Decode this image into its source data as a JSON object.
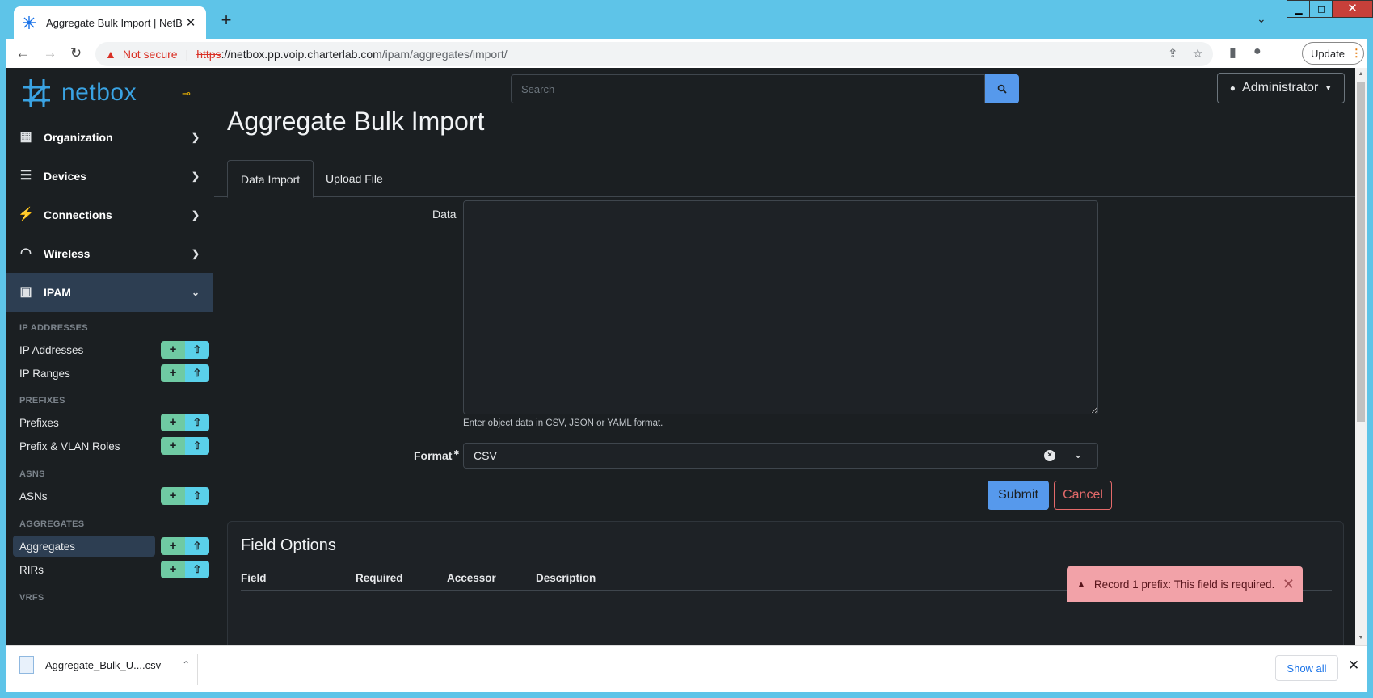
{
  "browser": {
    "tab_title": "Aggregate Bulk Import | NetBox",
    "new_tab": "+",
    "security_label": "Not secure",
    "url_scheme": "https",
    "url_host": "://netbox.pp.voip.charterlab.com",
    "url_path": "/ipam/aggregates/import/",
    "update_label": "Update",
    "update_dots": "⋮"
  },
  "app": {
    "logo_text": "netbox",
    "search_placeholder": "Search",
    "user_label": "Administrator"
  },
  "sidebar": {
    "menus": [
      {
        "label": "Organization",
        "icon": "building-icon"
      },
      {
        "label": "Devices",
        "icon": "server-icon"
      },
      {
        "label": "Connections",
        "icon": "plug-icon"
      },
      {
        "label": "Wireless",
        "icon": "wifi-icon"
      },
      {
        "label": "IPAM",
        "icon": "ipam-icon"
      }
    ],
    "sections": [
      {
        "heading": "IP ADDRESSES",
        "items": [
          "IP Addresses",
          "IP Ranges"
        ]
      },
      {
        "heading": "PREFIXES",
        "items": [
          "Prefixes",
          "Prefix & VLAN Roles"
        ]
      },
      {
        "heading": "ASNS",
        "items": [
          "ASNs"
        ]
      },
      {
        "heading": "AGGREGATES",
        "items": [
          "Aggregates",
          "RIRs"
        ]
      }
    ],
    "partial_section": "VRFS",
    "selected_item": "Aggregates"
  },
  "main": {
    "title": "Aggregate Bulk Import",
    "tabs": [
      "Data Import",
      "Upload File"
    ],
    "data_label": "Data",
    "data_help": "Enter object data in CSV, JSON or YAML format.",
    "format_label": "Format",
    "format_value": "CSV",
    "submit_label": "Submit",
    "cancel_label": "Cancel"
  },
  "field_options": {
    "title": "Field Options",
    "columns": [
      "Field",
      "Required",
      "Accessor",
      "Description"
    ]
  },
  "toast": {
    "message": "Record 1 prefix: This field is required."
  },
  "downloads": {
    "filename": "Aggregate_Bulk_U....csv",
    "show_all": "Show all"
  },
  "colors": {
    "accent": "#5699ec",
    "sidebar_active": "#2d3e52",
    "add_btn": "#6fcaa3",
    "import_btn": "#5ad0ea",
    "cancel": "#e46a6a",
    "toast_bg": "#f2a2a8"
  }
}
